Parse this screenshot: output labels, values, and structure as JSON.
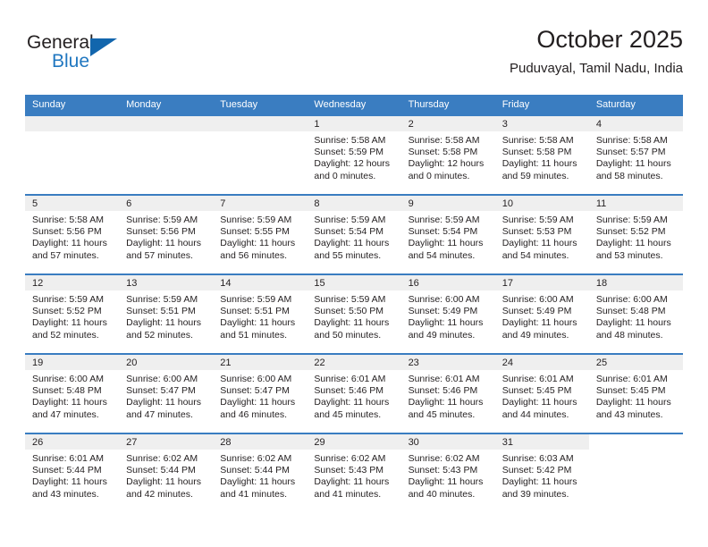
{
  "brand": {
    "name_top": "General",
    "name_bottom": "Blue",
    "accent_color": "#2077c0",
    "triangle_color": "#1266ad"
  },
  "header": {
    "title": "October 2025",
    "subtitle": "Puduvayal, Tamil Nadu, India"
  },
  "calendar": {
    "header_bg": "#3a7dc1",
    "daynum_bg": "#efefef",
    "weekdays": [
      "Sunday",
      "Monday",
      "Tuesday",
      "Wednesday",
      "Thursday",
      "Friday",
      "Saturday"
    ],
    "weeks": [
      [
        {
          "day": "",
          "empty": true
        },
        {
          "day": "",
          "empty": true
        },
        {
          "day": "",
          "empty": true
        },
        {
          "day": "1",
          "sunrise": "Sunrise: 5:58 AM",
          "sunset": "Sunset: 5:59 PM",
          "daylight": "Daylight: 12 hours and 0 minutes."
        },
        {
          "day": "2",
          "sunrise": "Sunrise: 5:58 AM",
          "sunset": "Sunset: 5:58 PM",
          "daylight": "Daylight: 12 hours and 0 minutes."
        },
        {
          "day": "3",
          "sunrise": "Sunrise: 5:58 AM",
          "sunset": "Sunset: 5:58 PM",
          "daylight": "Daylight: 11 hours and 59 minutes."
        },
        {
          "day": "4",
          "sunrise": "Sunrise: 5:58 AM",
          "sunset": "Sunset: 5:57 PM",
          "daylight": "Daylight: 11 hours and 58 minutes."
        }
      ],
      [
        {
          "day": "5",
          "sunrise": "Sunrise: 5:58 AM",
          "sunset": "Sunset: 5:56 PM",
          "daylight": "Daylight: 11 hours and 57 minutes."
        },
        {
          "day": "6",
          "sunrise": "Sunrise: 5:59 AM",
          "sunset": "Sunset: 5:56 PM",
          "daylight": "Daylight: 11 hours and 57 minutes."
        },
        {
          "day": "7",
          "sunrise": "Sunrise: 5:59 AM",
          "sunset": "Sunset: 5:55 PM",
          "daylight": "Daylight: 11 hours and 56 minutes."
        },
        {
          "day": "8",
          "sunrise": "Sunrise: 5:59 AM",
          "sunset": "Sunset: 5:54 PM",
          "daylight": "Daylight: 11 hours and 55 minutes."
        },
        {
          "day": "9",
          "sunrise": "Sunrise: 5:59 AM",
          "sunset": "Sunset: 5:54 PM",
          "daylight": "Daylight: 11 hours and 54 minutes."
        },
        {
          "day": "10",
          "sunrise": "Sunrise: 5:59 AM",
          "sunset": "Sunset: 5:53 PM",
          "daylight": "Daylight: 11 hours and 54 minutes."
        },
        {
          "day": "11",
          "sunrise": "Sunrise: 5:59 AM",
          "sunset": "Sunset: 5:52 PM",
          "daylight": "Daylight: 11 hours and 53 minutes."
        }
      ],
      [
        {
          "day": "12",
          "sunrise": "Sunrise: 5:59 AM",
          "sunset": "Sunset: 5:52 PM",
          "daylight": "Daylight: 11 hours and 52 minutes."
        },
        {
          "day": "13",
          "sunrise": "Sunrise: 5:59 AM",
          "sunset": "Sunset: 5:51 PM",
          "daylight": "Daylight: 11 hours and 52 minutes."
        },
        {
          "day": "14",
          "sunrise": "Sunrise: 5:59 AM",
          "sunset": "Sunset: 5:51 PM",
          "daylight": "Daylight: 11 hours and 51 minutes."
        },
        {
          "day": "15",
          "sunrise": "Sunrise: 5:59 AM",
          "sunset": "Sunset: 5:50 PM",
          "daylight": "Daylight: 11 hours and 50 minutes."
        },
        {
          "day": "16",
          "sunrise": "Sunrise: 6:00 AM",
          "sunset": "Sunset: 5:49 PM",
          "daylight": "Daylight: 11 hours and 49 minutes."
        },
        {
          "day": "17",
          "sunrise": "Sunrise: 6:00 AM",
          "sunset": "Sunset: 5:49 PM",
          "daylight": "Daylight: 11 hours and 49 minutes."
        },
        {
          "day": "18",
          "sunrise": "Sunrise: 6:00 AM",
          "sunset": "Sunset: 5:48 PM",
          "daylight": "Daylight: 11 hours and 48 minutes."
        }
      ],
      [
        {
          "day": "19",
          "sunrise": "Sunrise: 6:00 AM",
          "sunset": "Sunset: 5:48 PM",
          "daylight": "Daylight: 11 hours and 47 minutes."
        },
        {
          "day": "20",
          "sunrise": "Sunrise: 6:00 AM",
          "sunset": "Sunset: 5:47 PM",
          "daylight": "Daylight: 11 hours and 47 minutes."
        },
        {
          "day": "21",
          "sunrise": "Sunrise: 6:00 AM",
          "sunset": "Sunset: 5:47 PM",
          "daylight": "Daylight: 11 hours and 46 minutes."
        },
        {
          "day": "22",
          "sunrise": "Sunrise: 6:01 AM",
          "sunset": "Sunset: 5:46 PM",
          "daylight": "Daylight: 11 hours and 45 minutes."
        },
        {
          "day": "23",
          "sunrise": "Sunrise: 6:01 AM",
          "sunset": "Sunset: 5:46 PM",
          "daylight": "Daylight: 11 hours and 45 minutes."
        },
        {
          "day": "24",
          "sunrise": "Sunrise: 6:01 AM",
          "sunset": "Sunset: 5:45 PM",
          "daylight": "Daylight: 11 hours and 44 minutes."
        },
        {
          "day": "25",
          "sunrise": "Sunrise: 6:01 AM",
          "sunset": "Sunset: 5:45 PM",
          "daylight": "Daylight: 11 hours and 43 minutes."
        }
      ],
      [
        {
          "day": "26",
          "sunrise": "Sunrise: 6:01 AM",
          "sunset": "Sunset: 5:44 PM",
          "daylight": "Daylight: 11 hours and 43 minutes."
        },
        {
          "day": "27",
          "sunrise": "Sunrise: 6:02 AM",
          "sunset": "Sunset: 5:44 PM",
          "daylight": "Daylight: 11 hours and 42 minutes."
        },
        {
          "day": "28",
          "sunrise": "Sunrise: 6:02 AM",
          "sunset": "Sunset: 5:44 PM",
          "daylight": "Daylight: 11 hours and 41 minutes."
        },
        {
          "day": "29",
          "sunrise": "Sunrise: 6:02 AM",
          "sunset": "Sunset: 5:43 PM",
          "daylight": "Daylight: 11 hours and 41 minutes."
        },
        {
          "day": "30",
          "sunrise": "Sunrise: 6:02 AM",
          "sunset": "Sunset: 5:43 PM",
          "daylight": "Daylight: 11 hours and 40 minutes."
        },
        {
          "day": "31",
          "sunrise": "Sunrise: 6:03 AM",
          "sunset": "Sunset: 5:42 PM",
          "daylight": "Daylight: 11 hours and 39 minutes."
        },
        {
          "day": "",
          "empty": true,
          "blank": true
        }
      ]
    ]
  }
}
